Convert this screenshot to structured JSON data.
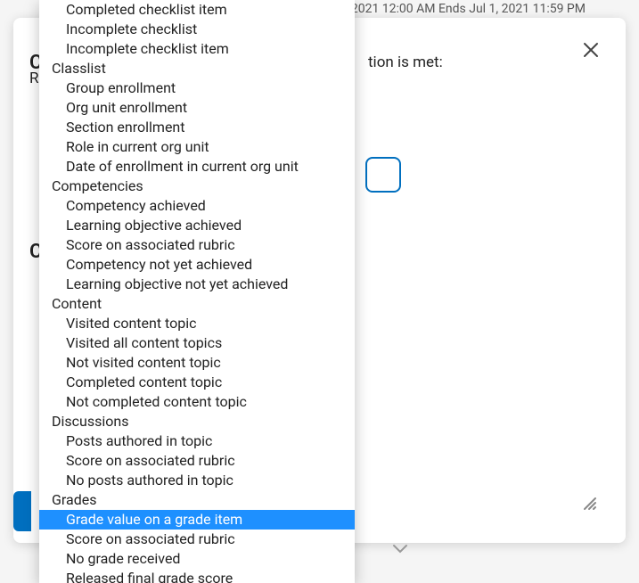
{
  "header": {
    "dates": "2021 12:00 AM   Ends Jul 1, 2021 11:59 PM"
  },
  "modal": {
    "body_tail": "tion is met:",
    "peek1": "C",
    "peek2": "C",
    "body_peek": "R"
  },
  "dropdown": {
    "groups": [
      {
        "label": null,
        "items": [
          {
            "label": "Completed checklist item",
            "highlight": false
          },
          {
            "label": "Incomplete checklist",
            "highlight": false
          },
          {
            "label": "Incomplete checklist item",
            "highlight": false
          }
        ]
      },
      {
        "label": "Classlist",
        "items": [
          {
            "label": "Group enrollment",
            "highlight": false
          },
          {
            "label": "Org unit enrollment",
            "highlight": false
          },
          {
            "label": "Section enrollment",
            "highlight": false
          },
          {
            "label": "Role in current org unit",
            "highlight": false
          },
          {
            "label": "Date of enrollment in current org unit",
            "highlight": false
          }
        ]
      },
      {
        "label": "Competencies",
        "items": [
          {
            "label": "Competency achieved",
            "highlight": false
          },
          {
            "label": "Learning objective achieved",
            "highlight": false
          },
          {
            "label": "Score on associated rubric",
            "highlight": false
          },
          {
            "label": "Competency not yet achieved",
            "highlight": false
          },
          {
            "label": "Learning objective not yet achieved",
            "highlight": false
          }
        ]
      },
      {
        "label": "Content",
        "items": [
          {
            "label": "Visited content topic",
            "highlight": false
          },
          {
            "label": "Visited all content topics",
            "highlight": false
          },
          {
            "label": "Not visited content topic",
            "highlight": false
          },
          {
            "label": "Completed content topic",
            "highlight": false
          },
          {
            "label": "Not completed content topic",
            "highlight": false
          }
        ]
      },
      {
        "label": "Discussions",
        "items": [
          {
            "label": "Posts authored in topic",
            "highlight": false
          },
          {
            "label": "Score on associated rubric",
            "highlight": false
          },
          {
            "label": "No posts authored in topic",
            "highlight": false
          }
        ]
      },
      {
        "label": "Grades",
        "items": [
          {
            "label": "Grade value on a grade item",
            "highlight": true
          },
          {
            "label": "Score on associated rubric",
            "highlight": false
          },
          {
            "label": "No grade received",
            "highlight": false
          },
          {
            "label": "Released final grade score",
            "highlight": false
          }
        ]
      }
    ]
  }
}
